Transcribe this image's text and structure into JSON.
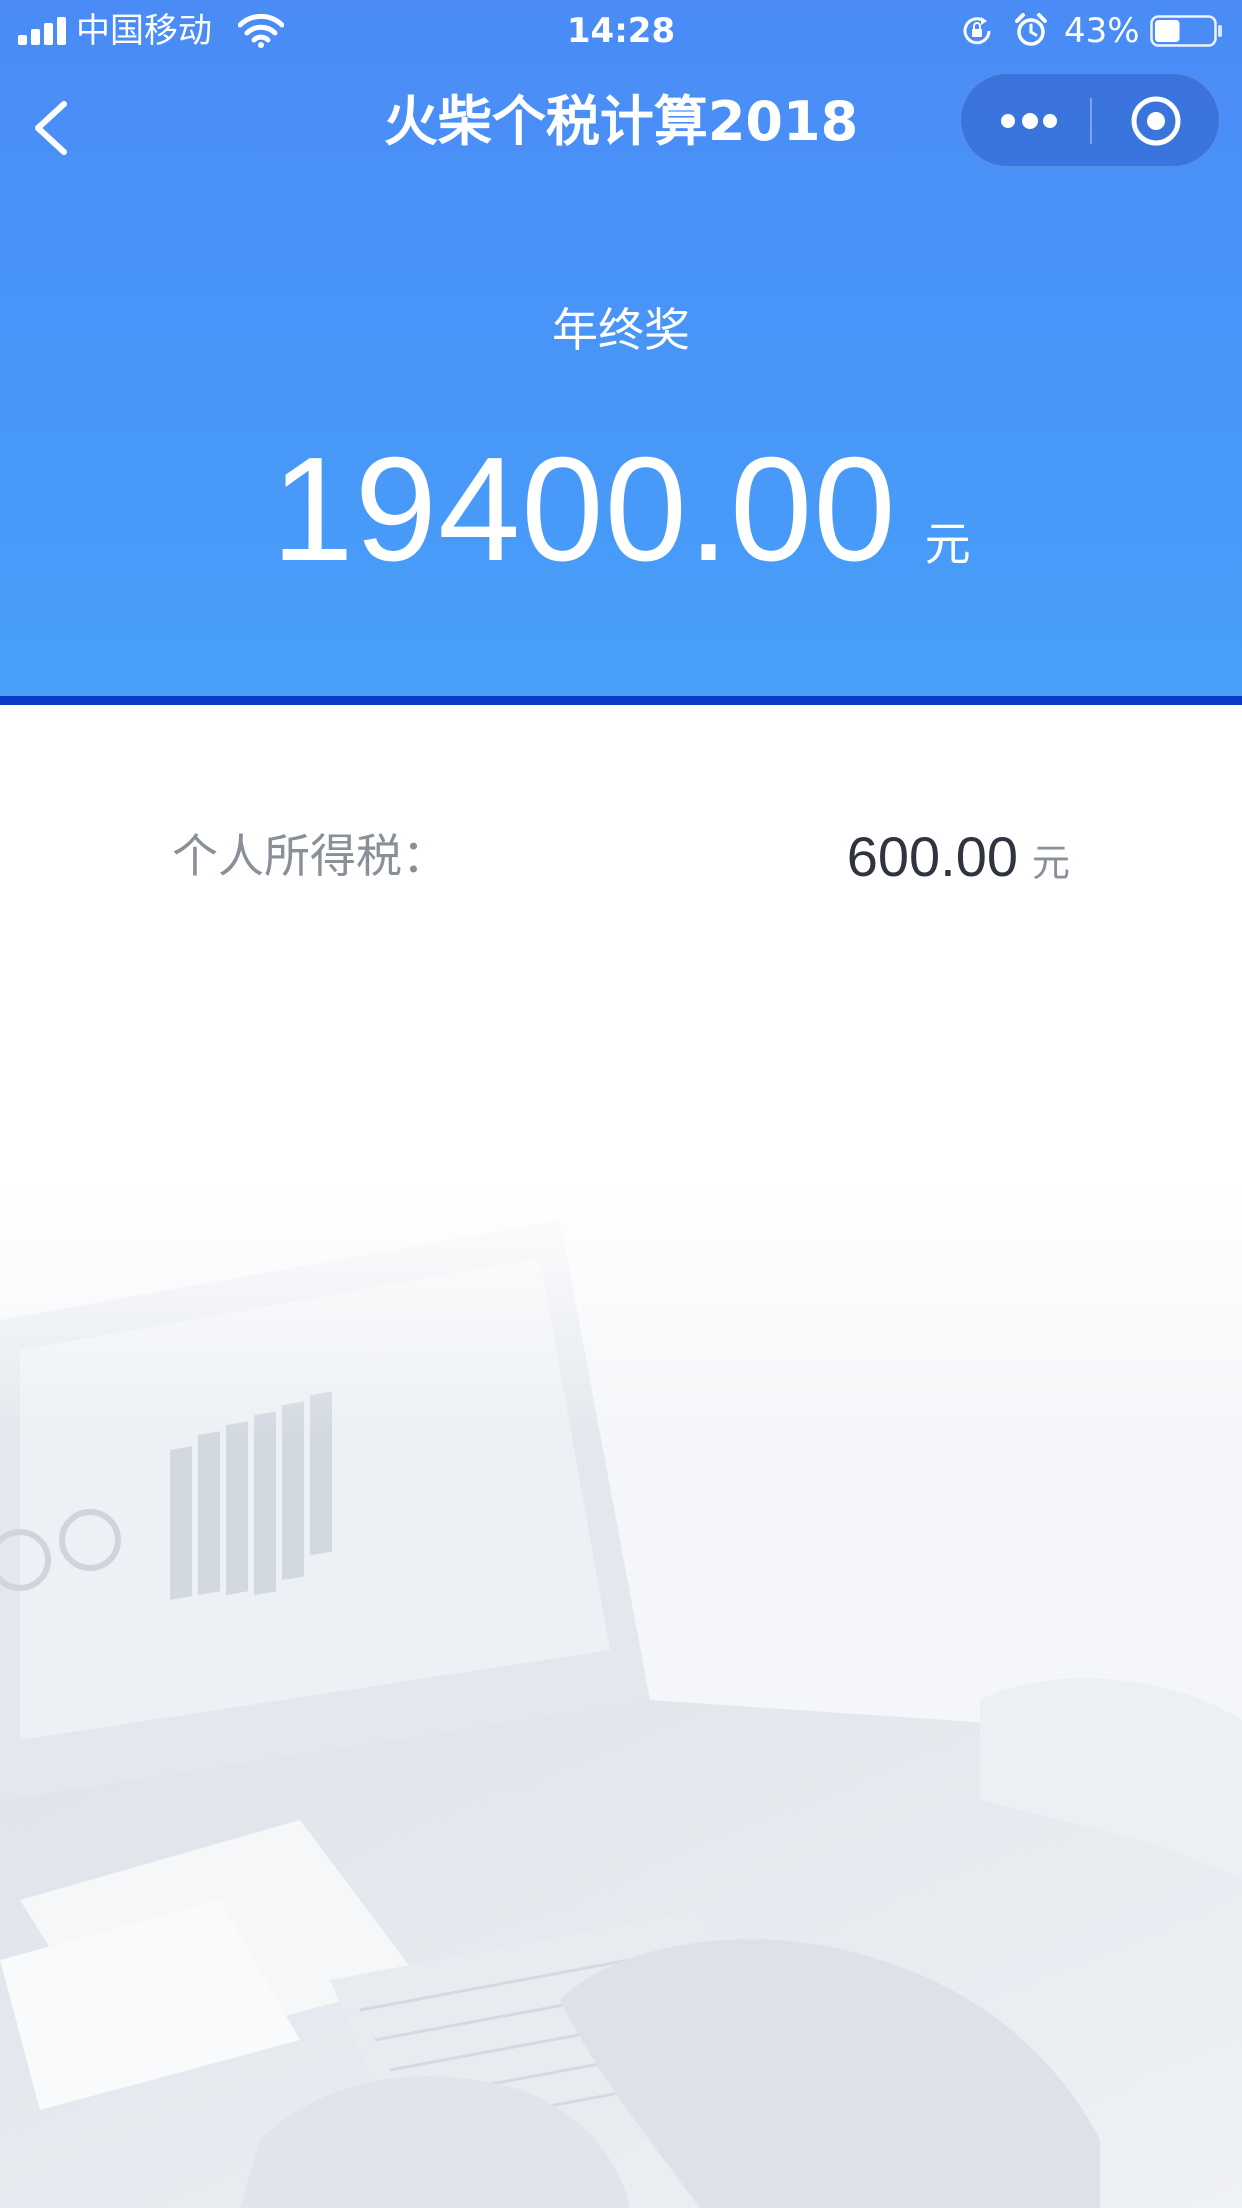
{
  "status_bar": {
    "carrier": "中国移动",
    "time": "14:28",
    "battery_percent": "43%",
    "battery_level": 0.43,
    "icons": [
      "signal-icon",
      "wifi-icon",
      "rotation-lock-icon",
      "alarm-icon",
      "battery-icon"
    ]
  },
  "nav": {
    "title": "火柴个税计算2018",
    "back_icon": "chevron-left-icon",
    "more_icon": "more-dots-icon",
    "close_icon": "miniprogram-close-icon"
  },
  "hero": {
    "label": "年终奖",
    "amount": "19400.00",
    "unit": "元"
  },
  "result": {
    "label": "个人所得税：",
    "value": "600.00",
    "unit": "元"
  },
  "colors": {
    "header_top": "#4a8bf6",
    "header_bottom": "#489ff8",
    "header_rule": "#0a3bc8",
    "label_gray": "#8a9099",
    "value_dark": "#2f3440"
  }
}
